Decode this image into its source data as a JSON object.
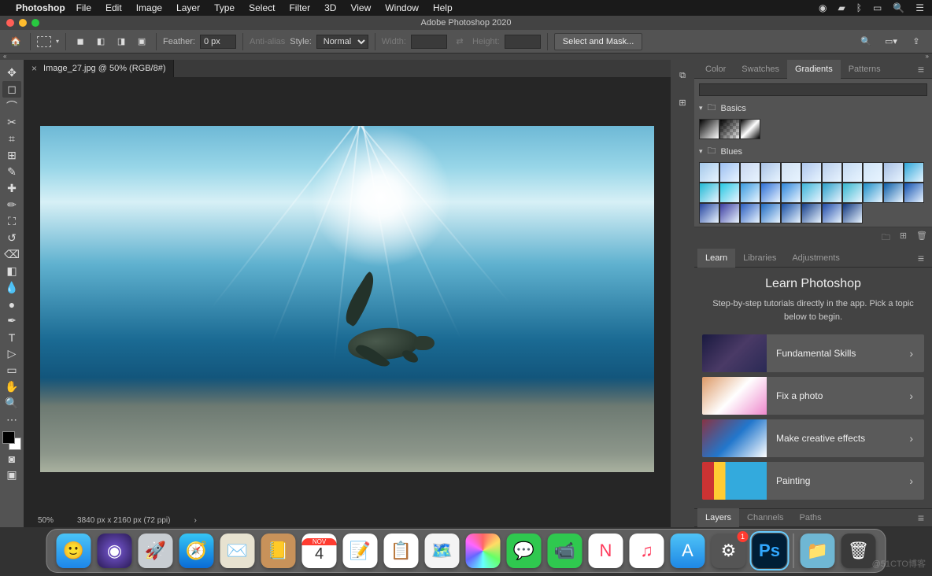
{
  "menubar": {
    "app": "Photoshop",
    "items": [
      "File",
      "Edit",
      "Image",
      "Layer",
      "Type",
      "Select",
      "Filter",
      "3D",
      "View",
      "Window",
      "Help"
    ]
  },
  "titlebar": {
    "title": "Adobe Photoshop 2020"
  },
  "options": {
    "feather_label": "Feather:",
    "feather_value": "0 px",
    "antialias": "Anti-alias",
    "style_label": "Style:",
    "style_value": "Normal",
    "width_label": "Width:",
    "height_label": "Height:",
    "select_mask": "Select and Mask..."
  },
  "document": {
    "tab_label": "Image_27.jpg @ 50% (RGB/8#)",
    "zoom": "50%",
    "dims": "3840 px x 2160 px (72 ppi)"
  },
  "panels": {
    "row1": {
      "tabs": [
        "Color",
        "Swatches",
        "Gradients",
        "Patterns"
      ],
      "active": 2
    },
    "gradient_groups": [
      {
        "name": "Basics"
      },
      {
        "name": "Blues"
      }
    ],
    "blues_colors": [
      [
        "#a4c8ea",
        "#9cbff1",
        "#c8d6ef",
        "#a9c3e6",
        "#cfe0f2",
        "#aec6ec",
        "#b7ccea",
        "#c3d9f1",
        "#cfe3f6",
        "#a7bfe3"
      ],
      [
        "#2ea7d9",
        "#1fb8d4",
        "#26c7e2",
        "#3a9be0",
        "#2d6fd6",
        "#2d86da",
        "#3cb5d8",
        "#2aa0c9",
        "#35b7cf",
        "#1e8fc8"
      ],
      [
        "#0d5ea8",
        "#1251b0",
        "#24449f",
        "#3b3ca0",
        "#2b5ec0",
        "#1f6bc2",
        "#184fa4",
        "#143e8a",
        "#1e4aa8",
        "#0f367e"
      ]
    ],
    "row2": {
      "tabs": [
        "Learn",
        "Libraries",
        "Adjustments"
      ],
      "active": 0
    },
    "learn": {
      "heading": "Learn Photoshop",
      "subtext": "Step-by-step tutorials directly in the app. Pick a topic below to begin.",
      "items": [
        "Fundamental Skills",
        "Fix a photo",
        "Make creative effects",
        "Painting"
      ]
    },
    "row3": {
      "tabs": [
        "Layers",
        "Channels",
        "Paths"
      ],
      "active": 0
    }
  },
  "dock": {
    "icons": [
      "Finder",
      "Siri",
      "Launchpad",
      "Safari",
      "Mail",
      "Contacts",
      "Calendar",
      "Notes",
      "Reminders",
      "Maps",
      "Photos",
      "Messages",
      "FaceTime",
      "News",
      "Music",
      "AppStore",
      "Settings",
      "Photoshop"
    ],
    "calendar": {
      "month": "NOV",
      "day": "4"
    },
    "settings_badge": "1"
  },
  "watermark": "@51CTO博客"
}
